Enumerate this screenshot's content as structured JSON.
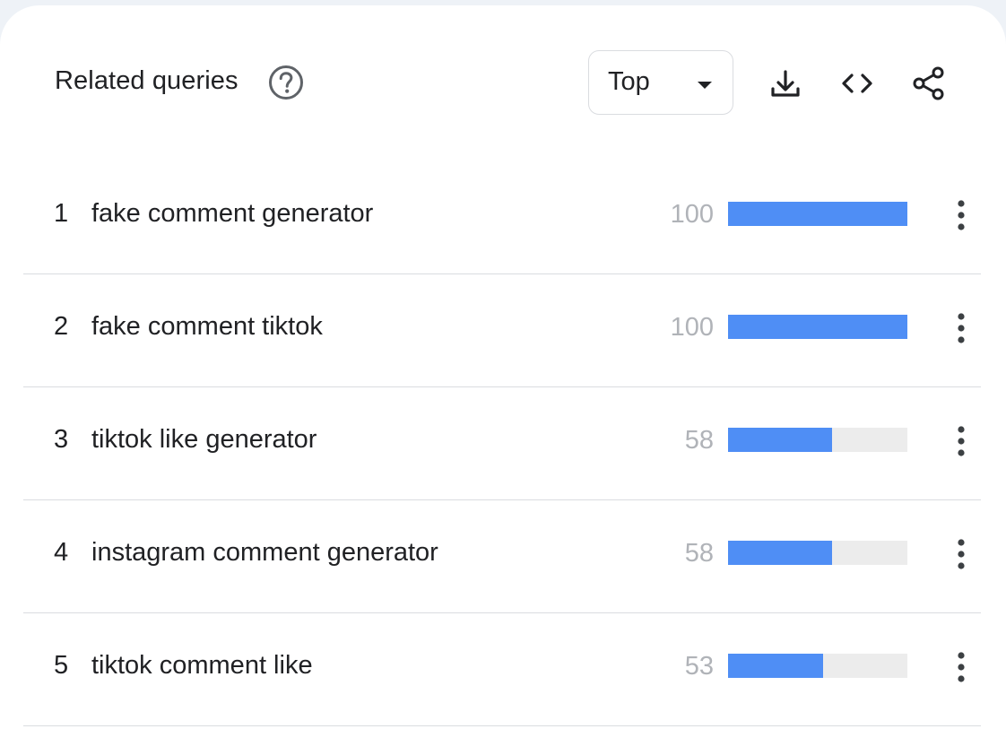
{
  "header": {
    "title": "Related queries",
    "help_icon": "help-circle-icon",
    "select": {
      "value": "Top",
      "icon": "caret-down-icon"
    },
    "tools": [
      {
        "name": "download",
        "icon": "download-icon"
      },
      {
        "name": "embed",
        "icon": "code-icon"
      },
      {
        "name": "share",
        "icon": "share-icon"
      }
    ]
  },
  "rows": [
    {
      "rank": "1",
      "query": "fake comment generator",
      "value": "100",
      "bar_fraction": 1.0
    },
    {
      "rank": "2",
      "query": "fake comment tiktok",
      "value": "100",
      "bar_fraction": 1.0
    },
    {
      "rank": "3",
      "query": "tiktok like generator",
      "value": "58",
      "bar_fraction": 0.58
    },
    {
      "rank": "4",
      "query": "instagram comment generator",
      "value": "58",
      "bar_fraction": 0.58
    },
    {
      "rank": "5",
      "query": "tiktok comment like",
      "value": "53",
      "bar_fraction": 0.53
    }
  ],
  "row_menu_icon": "more-vertical-icon",
  "colors": {
    "bar": "#4f8ef5",
    "bar_track": "#ececec",
    "value_text": "#b0b3b8",
    "divider": "#dadce0"
  }
}
